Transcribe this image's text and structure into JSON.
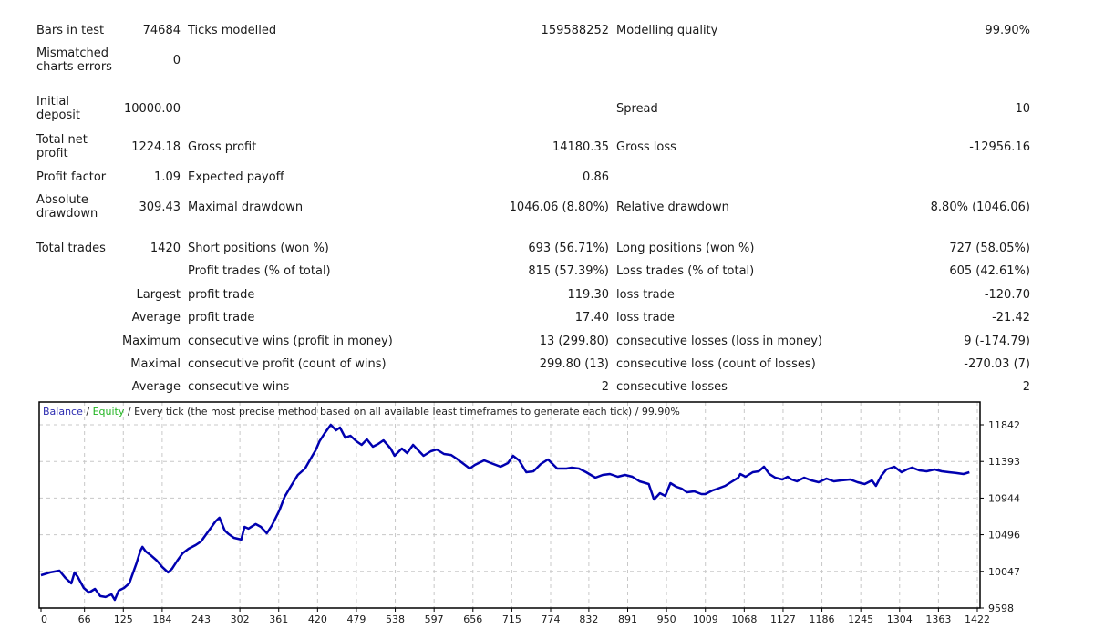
{
  "report": {
    "bars_in_test": {
      "label": "Bars in test",
      "value": "74684"
    },
    "ticks_modelled": {
      "label": "Ticks modelled",
      "value": "159588252"
    },
    "modelling_quality": {
      "label": "Modelling quality",
      "value": "99.90%"
    },
    "mismatched": {
      "label_line1": "Mismatched",
      "label_line2": "charts errors",
      "value": "0"
    },
    "initial_deposit": {
      "label_line1": "Initial",
      "label_line2": "deposit",
      "value": "10000.00"
    },
    "spread": {
      "label": "Spread",
      "value": "10"
    },
    "total_net_profit": {
      "label_line1": "Total net",
      "label_line2": "profit",
      "value": "1224.18"
    },
    "gross_profit": {
      "label": "Gross profit",
      "value": "14180.35"
    },
    "gross_loss": {
      "label": "Gross loss",
      "value": "-12956.16"
    },
    "profit_factor": {
      "label": "Profit factor",
      "value": "1.09"
    },
    "expected_payoff": {
      "label": "Expected payoff",
      "value": "0.86"
    },
    "absolute_drawdown": {
      "label_line1": "Absolute",
      "label_line2": "drawdown",
      "value": "309.43"
    },
    "maximal_drawdown": {
      "label": "Maximal drawdown",
      "value": "1046.06 (8.80%)"
    },
    "relative_drawdown": {
      "label": "Relative drawdown",
      "value": "8.80% (1046.06)"
    },
    "total_trades": {
      "label": "Total trades",
      "value": "1420"
    },
    "short_positions": {
      "label": "Short positions (won %)",
      "value": "693 (56.71%)"
    },
    "long_positions": {
      "label": "Long positions (won %)",
      "value": "727 (58.05%)"
    },
    "profit_trades": {
      "label": "Profit trades (% of total)",
      "value": "815 (57.39%)"
    },
    "loss_trades": {
      "label": "Loss trades (% of total)",
      "value": "605 (42.61%)"
    },
    "largest": {
      "prefix": "Largest",
      "profit_label": "profit trade",
      "profit_value": "119.30",
      "loss_label": "loss trade",
      "loss_value": "-120.70"
    },
    "average": {
      "prefix": "Average",
      "profit_label": "profit trade",
      "profit_value": "17.40",
      "loss_label": "loss trade",
      "loss_value": "-21.42"
    },
    "maximum": {
      "prefix": "Maximum",
      "wins_label": "consecutive wins (profit in money)",
      "wins_value": "13 (299.80)",
      "losses_label": "consecutive losses (loss in money)",
      "losses_value": "9 (-174.79)"
    },
    "maximal": {
      "prefix": "Maximal",
      "profit_label": "consecutive profit (count of wins)",
      "profit_value": "299.80 (13)",
      "loss_label": "consecutive loss (count of losses)",
      "loss_value": "-270.03 (7)"
    },
    "average_consecutive": {
      "prefix": "Average",
      "wins_label": "consecutive wins",
      "wins_value": "2",
      "losses_label": "consecutive losses",
      "losses_value": "2"
    }
  },
  "chart_data": {
    "type": "line",
    "title_parts": {
      "balance": "Balance",
      "sep1": " / ",
      "equity": "Equity",
      "rest": " / Every tick (the most precise method based on all available least timeframes to generate each tick) / 99.90%"
    },
    "colors": {
      "balance": "#0000b0",
      "equity": "#22b522",
      "grid": "#c8c8c8",
      "frame": "#000000"
    },
    "xlabel": "",
    "ylabel": "",
    "xlim": [
      0,
      1422
    ],
    "ylim": [
      9598,
      11842
    ],
    "x_ticks": [
      0,
      66,
      125,
      184,
      243,
      302,
      361,
      420,
      479,
      538,
      597,
      656,
      715,
      774,
      832,
      891,
      950,
      1009,
      1068,
      1127,
      1186,
      1245,
      1304,
      1363,
      1422
    ],
    "y_ticks": [
      11842,
      11393,
      10944,
      10496,
      10047,
      9598
    ],
    "grid": true,
    "series": [
      {
        "name": "Balance",
        "points": [
          [
            0,
            10000
          ],
          [
            14,
            10034
          ],
          [
            28,
            10056
          ],
          [
            37,
            9967
          ],
          [
            46,
            9900
          ],
          [
            51,
            10034
          ],
          [
            56,
            9978
          ],
          [
            65,
            9844
          ],
          [
            73,
            9788
          ],
          [
            82,
            9833
          ],
          [
            90,
            9744
          ],
          [
            98,
            9733
          ],
          [
            107,
            9766
          ],
          [
            112,
            9699
          ],
          [
            118,
            9811
          ],
          [
            126,
            9844
          ],
          [
            134,
            9900
          ],
          [
            140,
            10034
          ],
          [
            145,
            10146
          ],
          [
            151,
            10302
          ],
          [
            154,
            10347
          ],
          [
            159,
            10291
          ],
          [
            168,
            10235
          ],
          [
            176,
            10179
          ],
          [
            184,
            10101
          ],
          [
            193,
            10034
          ],
          [
            199,
            10079
          ],
          [
            207,
            10179
          ],
          [
            215,
            10268
          ],
          [
            224,
            10324
          ],
          [
            235,
            10369
          ],
          [
            243,
            10413
          ],
          [
            254,
            10536
          ],
          [
            259,
            10592
          ],
          [
            265,
            10659
          ],
          [
            271,
            10704
          ],
          [
            279,
            10548
          ],
          [
            285,
            10503
          ],
          [
            293,
            10458
          ],
          [
            304,
            10436
          ],
          [
            309,
            10592
          ],
          [
            315,
            10570
          ],
          [
            326,
            10626
          ],
          [
            334,
            10592
          ],
          [
            343,
            10514
          ],
          [
            351,
            10614
          ],
          [
            362,
            10793
          ],
          [
            370,
            10960
          ],
          [
            379,
            11083
          ],
          [
            390,
            11228
          ],
          [
            401,
            11306
          ],
          [
            412,
            11462
          ],
          [
            417,
            11529
          ],
          [
            423,
            11641
          ],
          [
            431,
            11741
          ],
          [
            440,
            11842
          ],
          [
            448,
            11775
          ],
          [
            454,
            11808
          ],
          [
            462,
            11685
          ],
          [
            470,
            11708
          ],
          [
            479,
            11641
          ],
          [
            487,
            11596
          ],
          [
            495,
            11663
          ],
          [
            504,
            11574
          ],
          [
            512,
            11607
          ],
          [
            520,
            11652
          ],
          [
            531,
            11552
          ],
          [
            537,
            11462
          ],
          [
            548,
            11552
          ],
          [
            556,
            11496
          ],
          [
            565,
            11596
          ],
          [
            573,
            11529
          ],
          [
            581,
            11462
          ],
          [
            592,
            11518
          ],
          [
            601,
            11540
          ],
          [
            612,
            11485
          ],
          [
            623,
            11473
          ],
          [
            631,
            11429
          ],
          [
            642,
            11362
          ],
          [
            651,
            11306
          ],
          [
            659,
            11351
          ],
          [
            673,
            11407
          ],
          [
            687,
            11362
          ],
          [
            698,
            11329
          ],
          [
            709,
            11373
          ],
          [
            717,
            11462
          ],
          [
            726,
            11407
          ],
          [
            737,
            11262
          ],
          [
            748,
            11273
          ],
          [
            759,
            11362
          ],
          [
            770,
            11418
          ],
          [
            784,
            11306
          ],
          [
            798,
            11306
          ],
          [
            806,
            11317
          ],
          [
            817,
            11306
          ],
          [
            828,
            11262
          ],
          [
            842,
            11195
          ],
          [
            853,
            11228
          ],
          [
            864,
            11239
          ],
          [
            876,
            11206
          ],
          [
            887,
            11228
          ],
          [
            898,
            11206
          ],
          [
            909,
            11150
          ],
          [
            923,
            11116
          ],
          [
            931,
            10927
          ],
          [
            940,
            11005
          ],
          [
            948,
            10971
          ],
          [
            956,
            11128
          ],
          [
            965,
            11083
          ],
          [
            973,
            11061
          ],
          [
            981,
            11016
          ],
          [
            992,
            11027
          ],
          [
            1003,
            10994
          ],
          [
            1009,
            10994
          ],
          [
            1020,
            11039
          ],
          [
            1028,
            11061
          ],
          [
            1039,
            11094
          ],
          [
            1050,
            11150
          ],
          [
            1059,
            11195
          ],
          [
            1062,
            11239
          ],
          [
            1070,
            11206
          ],
          [
            1081,
            11262
          ],
          [
            1090,
            11273
          ],
          [
            1098,
            11329
          ],
          [
            1106,
            11240
          ],
          [
            1115,
            11195
          ],
          [
            1126,
            11172
          ],
          [
            1134,
            11206
          ],
          [
            1140,
            11172
          ],
          [
            1148,
            11150
          ],
          [
            1159,
            11195
          ],
          [
            1170,
            11161
          ],
          [
            1181,
            11139
          ],
          [
            1193,
            11183
          ],
          [
            1204,
            11150
          ],
          [
            1215,
            11161
          ],
          [
            1229,
            11172
          ],
          [
            1240,
            11139
          ],
          [
            1251,
            11116
          ],
          [
            1262,
            11161
          ],
          [
            1268,
            11094
          ],
          [
            1276,
            11217
          ],
          [
            1284,
            11295
          ],
          [
            1296,
            11329
          ],
          [
            1307,
            11262
          ],
          [
            1315,
            11295
          ],
          [
            1323,
            11318
          ],
          [
            1334,
            11284
          ],
          [
            1345,
            11273
          ],
          [
            1357,
            11295
          ],
          [
            1368,
            11273
          ],
          [
            1379,
            11262
          ],
          [
            1390,
            11251
          ],
          [
            1401,
            11239
          ],
          [
            1410,
            11262
          ]
        ]
      }
    ]
  }
}
